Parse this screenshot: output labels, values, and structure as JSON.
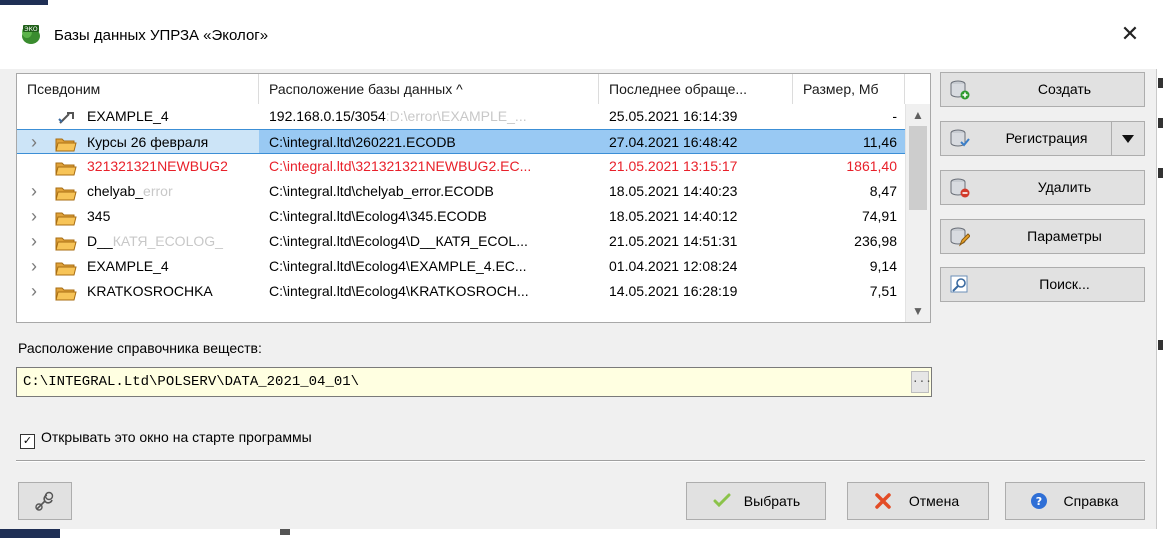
{
  "window": {
    "title": "Базы данных УПРЗА «Эколог»",
    "app_icon": "eco-app-icon",
    "close_glyph": "✕"
  },
  "grid": {
    "columns": [
      "Псевдоним",
      "Расположение базы данных  ^",
      "Последнее обраще...",
      "Размер, Мб"
    ],
    "rows": [
      {
        "alias": "EXAMPLE_4",
        "path": "192.168.0.15/3054",
        "path_faded": ":D:\\error\\EXAMPLE_...",
        "date": "25.05.2021 16:14:39",
        "size": "-",
        "icon": "link-icon",
        "expand": false,
        "selected": false,
        "red": false
      },
      {
        "alias": "Курсы 26 февраля",
        "path": "C:\\integral.ltd\\260221.ECODB",
        "path_faded": "",
        "date": "27.04.2021 16:48:42",
        "size": "11,46",
        "icon": "folder-open-icon",
        "expand": true,
        "selected": true,
        "red": false
      },
      {
        "alias": "321321321NEWBUG2",
        "path": "C:\\integral.ltd\\321321321NEWBUG2.EC...",
        "path_faded": "",
        "date": "21.05.2021 13:15:17",
        "size": "1861,40",
        "icon": "folder-open-icon",
        "expand": false,
        "selected": false,
        "red": true
      },
      {
        "alias": "chelyab_",
        "alias_faded": "error",
        "path": "C:\\integral.ltd\\chelyab_error.ECODB",
        "path_faded": "",
        "date": "18.05.2021 14:40:23",
        "size": "8,47",
        "icon": "folder-open-icon",
        "expand": true,
        "selected": false,
        "red": false
      },
      {
        "alias": "345",
        "path": "C:\\integral.ltd\\Ecolog4\\345.ECODB",
        "path_faded": "",
        "date": "18.05.2021 14:40:12",
        "size": "74,91",
        "icon": "folder-open-icon",
        "expand": true,
        "selected": false,
        "red": false
      },
      {
        "alias": "D__",
        "alias_faded": "КАТЯ_ECOLOG_",
        "path": "C:\\integral.ltd\\Ecolog4\\D__КАТЯ_ECOL...",
        "path_faded": "",
        "date": "21.05.2021 14:51:31",
        "size": "236,98",
        "icon": "folder-open-icon",
        "expand": true,
        "selected": false,
        "red": false
      },
      {
        "alias": "EXAMPLE_4",
        "path": "C:\\integral.ltd\\Ecolog4\\EXAMPLE_4.EC...",
        "path_faded": "",
        "date": "01.04.2021 12:08:24",
        "size": "9,14",
        "icon": "folder-open-icon",
        "expand": true,
        "selected": false,
        "red": false
      },
      {
        "alias": "KRATKOSROCHKA",
        "path": "C:\\integral.ltd\\Ecolog4\\KRATKOSROCH...",
        "path_faded": "",
        "date": "14.05.2021 16:28:19",
        "size": "7,51",
        "icon": "folder-open-icon",
        "expand": true,
        "selected": false,
        "red": false
      }
    ]
  },
  "side_buttons": {
    "create": "Создать",
    "register": "Регистрация",
    "delete": "Удалить",
    "params": "Параметры",
    "search": "Поиск..."
  },
  "reference": {
    "label": "Расположение справочника веществ:",
    "value": "C:\\INTEGRAL.Ltd\\POLSERV\\DATA_2021_04_01\\",
    "browse": "..."
  },
  "startup_checkbox": {
    "label": "Открывать это окно на старте программы",
    "checked": true
  },
  "bottom_buttons": {
    "select": "Выбрать",
    "cancel": "Отмена",
    "help": "Справка"
  },
  "colors": {
    "selection": "#99c9f3",
    "error_text": "#e8202a",
    "input_bg": "#ffffe1"
  }
}
